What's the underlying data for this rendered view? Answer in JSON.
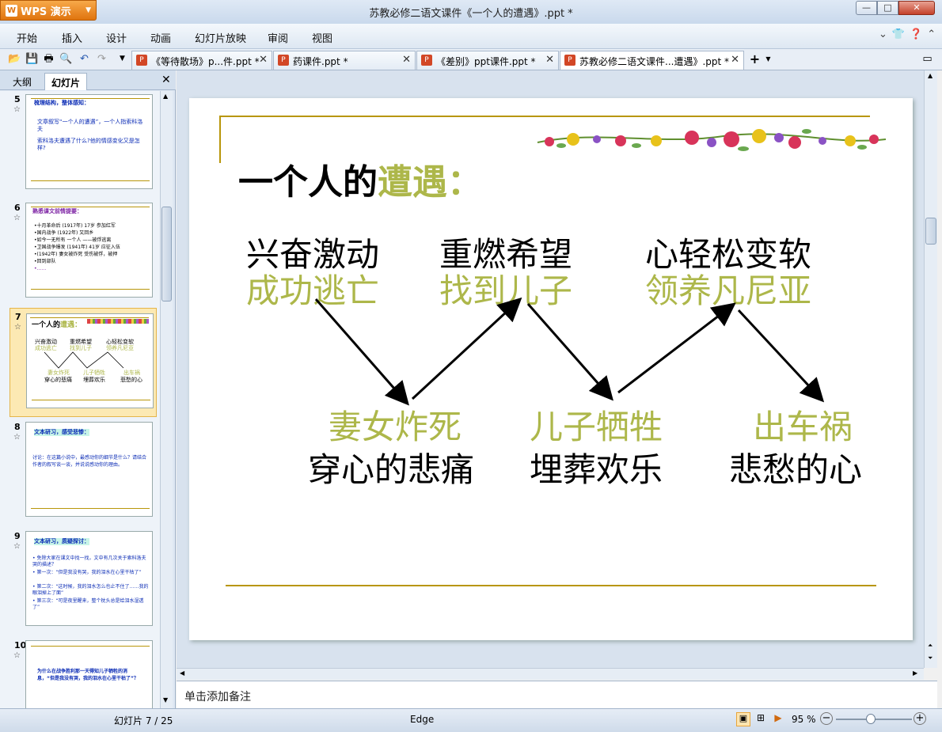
{
  "app": {
    "name": "WPS 演示",
    "window_title": "苏教必修二语文课件《一个人的遭遇》.ppt *"
  },
  "menu": [
    "开始",
    "插入",
    "设计",
    "动画",
    "幻灯片放映",
    "审阅",
    "视图"
  ],
  "tabs": [
    {
      "label": "《等待散场》p...件.ppt *",
      "active": false
    },
    {
      "label": "药课件.ppt *",
      "active": false
    },
    {
      "label": "《差别》ppt课件.ppt *",
      "active": false
    },
    {
      "label": "苏教必修二语文课件...遭遇》.ppt *",
      "active": true
    }
  ],
  "panel": {
    "tab_outline": "大纲",
    "tab_slides": "幻灯片"
  },
  "thumbnails": [
    {
      "num": "5",
      "title": "梳理结构，整体感知：",
      "lines": [
        "文章叙写“一个人的遭遇”，一个人指索科洛夫",
        "索科洛夫遭遇了什么?他的情感变化又是怎样?"
      ]
    },
    {
      "num": "6",
      "title": "熟悉课文前情提要：",
      "lines": [
        "•十月革命后  (1917年) 17岁  参加红军",
        "•国内战争  (1922年) 又回乡",
        "•如今一无所有  一个人  ——被俘逃离",
        "•卫国战争爆发  (1941年) 41岁  应征入伍",
        "•(1942年)  妻女被炸死  受伤被俘，被押",
        "•回到部队",
        "•……"
      ]
    },
    {
      "num": "7",
      "title": "一个人的遭遇：",
      "selected": true
    },
    {
      "num": "8",
      "title": "文本研习，感受悲惨：",
      "lines": [
        "讨论：在这篇小说中，最感动你的细节是什么？请结合作者的叙写谈一谈，并说说感动你的理由。"
      ]
    },
    {
      "num": "9",
      "title": "文本研习，质疑探讨：",
      "lines": [
        "• 免除大家在课文中找一找，文中有几次关于索科洛夫哭的描述？",
        "• 第一次：“但是我没有哭，我的泪水在心里干枯了”",
        "• 第二次：“这时候，我的泪水怎么也止不住了……我的眼泪掉上了面”",
        "• 第三次：“可是夜里醒来，整个枕头总是给泪水湿透了”"
      ]
    },
    {
      "num": "10",
      "lines": [
        "为什么在战争胜利那一天得知儿子牺牲的消息，“但是我没有哭，我的泪水在心里干枯了”？"
      ]
    }
  ],
  "slide": {
    "title_black": "一个人的",
    "title_olive": "遭遇：",
    "top_row": [
      {
        "black": "兴奋激动",
        "olive": "成功逃亡"
      },
      {
        "black": "重燃希望",
        "olive": "找到儿子"
      },
      {
        "black": "心轻松变软",
        "olive": "领养凡尼亚"
      }
    ],
    "bottom_row": [
      {
        "olive": "妻女炸死",
        "black": "穿心的悲痛"
      },
      {
        "olive": "儿子牺牲",
        "black": "埋葬欢乐"
      },
      {
        "olive": "出车祸",
        "black": "悲愁的心"
      }
    ]
  },
  "notes_placeholder": "单击添加备注",
  "status": {
    "slide_counter": "幻灯片 7 / 25",
    "theme": "Edge",
    "zoom": "95 %"
  },
  "colors": {
    "olive": "#adb74a",
    "gold_line": "#b8960a",
    "accent": "#e0740e"
  }
}
